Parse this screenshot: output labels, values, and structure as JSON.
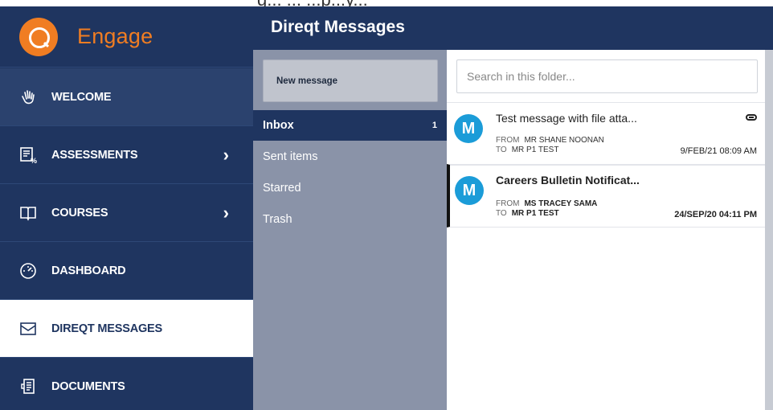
{
  "browser_fragment": "g... ... ...p...y...",
  "brand": {
    "name": "Engage"
  },
  "nav": {
    "items": [
      {
        "label": "WELCOME",
        "icon": "hand-wave-icon",
        "chevron": ""
      },
      {
        "label": "ASSESSMENTS",
        "icon": "assessment-icon",
        "chevron": "›"
      },
      {
        "label": "COURSES",
        "icon": "book-icon",
        "chevron": "›"
      },
      {
        "label": "DASHBOARD",
        "icon": "gauge-icon",
        "chevron": ""
      },
      {
        "label": "DIREQT MESSAGES",
        "icon": "envelope-icon",
        "chevron": ""
      },
      {
        "label": "DOCUMENTS",
        "icon": "documents-icon",
        "chevron": ""
      }
    ],
    "active": "DIREQT MESSAGES"
  },
  "header": {
    "title": "Direqt Messages"
  },
  "folders": {
    "new_message_label": "New message",
    "items": [
      {
        "label": "Inbox",
        "count": "1"
      },
      {
        "label": "Sent items",
        "count": ""
      },
      {
        "label": "Starred",
        "count": ""
      },
      {
        "label": "Trash",
        "count": ""
      }
    ]
  },
  "search": {
    "placeholder": "Search in this folder..."
  },
  "messages": [
    {
      "avatar": "M",
      "subject": "Test message with file atta...",
      "from_label": "FROM",
      "from": "MR SHANE NOONAN",
      "to_label": "TO",
      "to": "MR P1 TEST",
      "date": "9/FEB/21 08:09 AM",
      "has_attachment": true,
      "unread": false
    },
    {
      "avatar": "M",
      "subject": "Careers Bulletin Notificat...",
      "from_label": "FROM",
      "from": "MS TRACEY SAMA",
      "to_label": "TO",
      "to": "MR P1 TEST",
      "date": "24/SEP/20 04:11 PM",
      "has_attachment": false,
      "unread": true
    }
  ],
  "colors": {
    "nav_bg": "#1f3560",
    "brand_orange": "#f07d22",
    "folder_bg": "#8a93a8",
    "avatar_blue": "#1b9cd8"
  }
}
